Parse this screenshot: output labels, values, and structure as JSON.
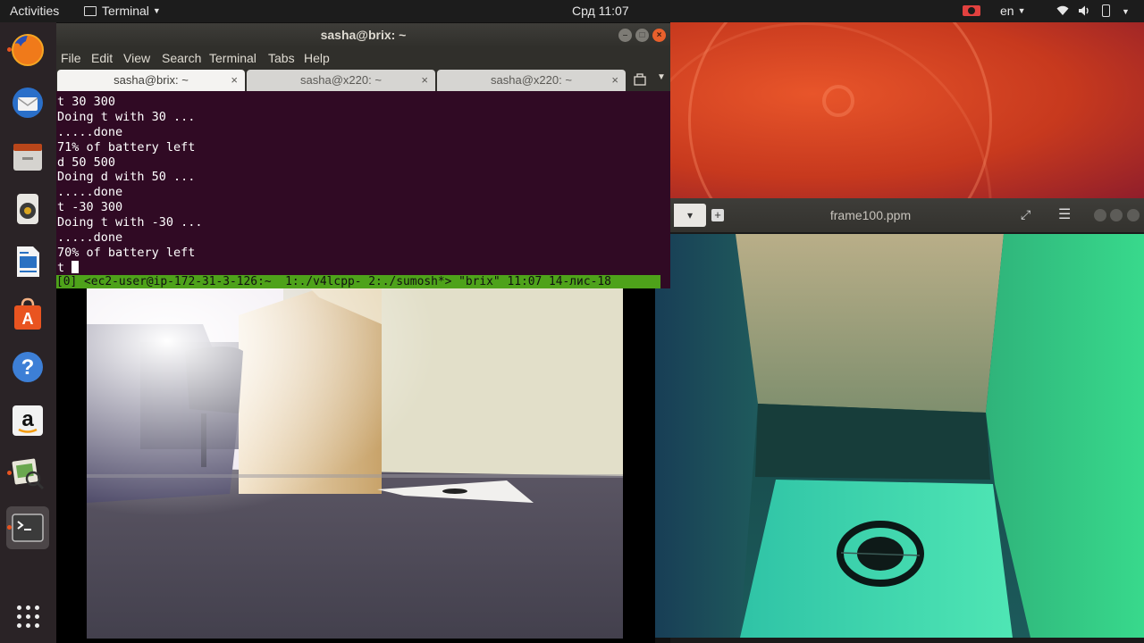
{
  "topbar": {
    "activities": "Activities",
    "app_menu": "Terminal",
    "clock": "Срд 11:07",
    "language": "en"
  },
  "dock": {
    "items": [
      {
        "name": "firefox",
        "icon": "firefox-icon"
      },
      {
        "name": "thunderbird",
        "icon": "mail-icon"
      },
      {
        "name": "files",
        "icon": "files-icon"
      },
      {
        "name": "rhythmbox",
        "icon": "music-icon"
      },
      {
        "name": "writer",
        "icon": "document-icon"
      },
      {
        "name": "software",
        "icon": "software-store-icon"
      },
      {
        "name": "help",
        "icon": "help-icon"
      },
      {
        "name": "amazon",
        "icon": "amazon-icon"
      },
      {
        "name": "image-viewer",
        "icon": "image-viewer-icon"
      },
      {
        "name": "terminal",
        "icon": "terminal-icon"
      }
    ]
  },
  "terminal": {
    "title": "sasha@brix: ~",
    "menu": [
      "File",
      "Edit",
      "View",
      "Search",
      "Terminal",
      "Tabs",
      "Help"
    ],
    "tabs": [
      {
        "label": "sasha@brix: ~"
      },
      {
        "label": "sasha@x220: ~"
      },
      {
        "label": "sasha@x220: ~"
      }
    ],
    "lines": [
      "t 30 300",
      "Doing t with 30 ...",
      ".....done",
      "71% of battery left",
      "d 50 500",
      "Doing d with 50 ...",
      ".....done",
      "t -30 300",
      "Doing t with -30 ...",
      ".....done",
      "70% of battery left"
    ],
    "prompt": "t ",
    "tmux_status": "[0] <ec2-user@ip-172-31-3-126:~  1:./v4lcpp- 2:./sumosh*> \"brix\" 11:07 14-лис-18"
  },
  "viewer": {
    "title": "frame100.ppm"
  },
  "colors": {
    "terminal_bg": "#300a24",
    "tmux_green": "#4ea21a",
    "ubuntu_orange": "#e95420",
    "topbar_bg": "#1c1c1c",
    "dock_bg": "#2a2326"
  }
}
